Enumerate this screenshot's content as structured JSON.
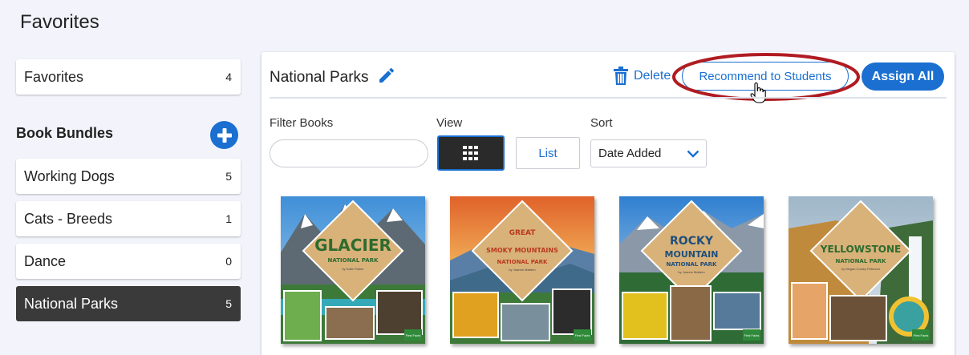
{
  "page": {
    "title": "Favorites"
  },
  "sidebar": {
    "favorites": {
      "label": "Favorites",
      "count": "4"
    },
    "bundles_heading": "Book Bundles",
    "bundles": [
      {
        "label": "Working Dogs",
        "count": "5"
      },
      {
        "label": "Cats - Breeds",
        "count": "1"
      },
      {
        "label": "Dance",
        "count": "0"
      },
      {
        "label": "National Parks",
        "count": "5",
        "active": true
      }
    ]
  },
  "panel": {
    "title": "National Parks",
    "delete_label": "Delete",
    "recommend_label": "Recommend to Students",
    "assign_label": "Assign All",
    "filter_label": "Filter Books",
    "filter_value": "",
    "view_label": "View",
    "list_label": "List",
    "sort_label": "Sort",
    "sort_value": "Date Added"
  },
  "books": [
    {
      "line1": "GLACIER",
      "line2": "",
      "line3": "NATIONAL PARK",
      "author": "by Katie Parker",
      "badge": "First Facts"
    },
    {
      "line1": "GREAT",
      "line2": "SMOKY MOUNTAINS",
      "line3": "NATIONAL PARK",
      "author": "by Joanne Mattern",
      "badge": "First Facts"
    },
    {
      "line1": "ROCKY",
      "line2": "MOUNTAIN",
      "line3": "NATIONAL PARK",
      "author": "by Joanne Mattern",
      "badge": "First Facts"
    },
    {
      "line1": "YELLOWSTONE",
      "line2": "",
      "line3": "NATIONAL PARK",
      "author": "by Megan Cooley Peterson",
      "badge": "First Facts"
    }
  ],
  "icons": {
    "add": "plus-circle-icon",
    "edit": "pencil-icon",
    "delete": "trash-icon",
    "grid": "grid-view-icon",
    "sort": "chevron-down-icon"
  },
  "colors": {
    "accent": "#1a6fd1",
    "active_bg": "#3a3a3a",
    "annotation": "#b01c22"
  }
}
